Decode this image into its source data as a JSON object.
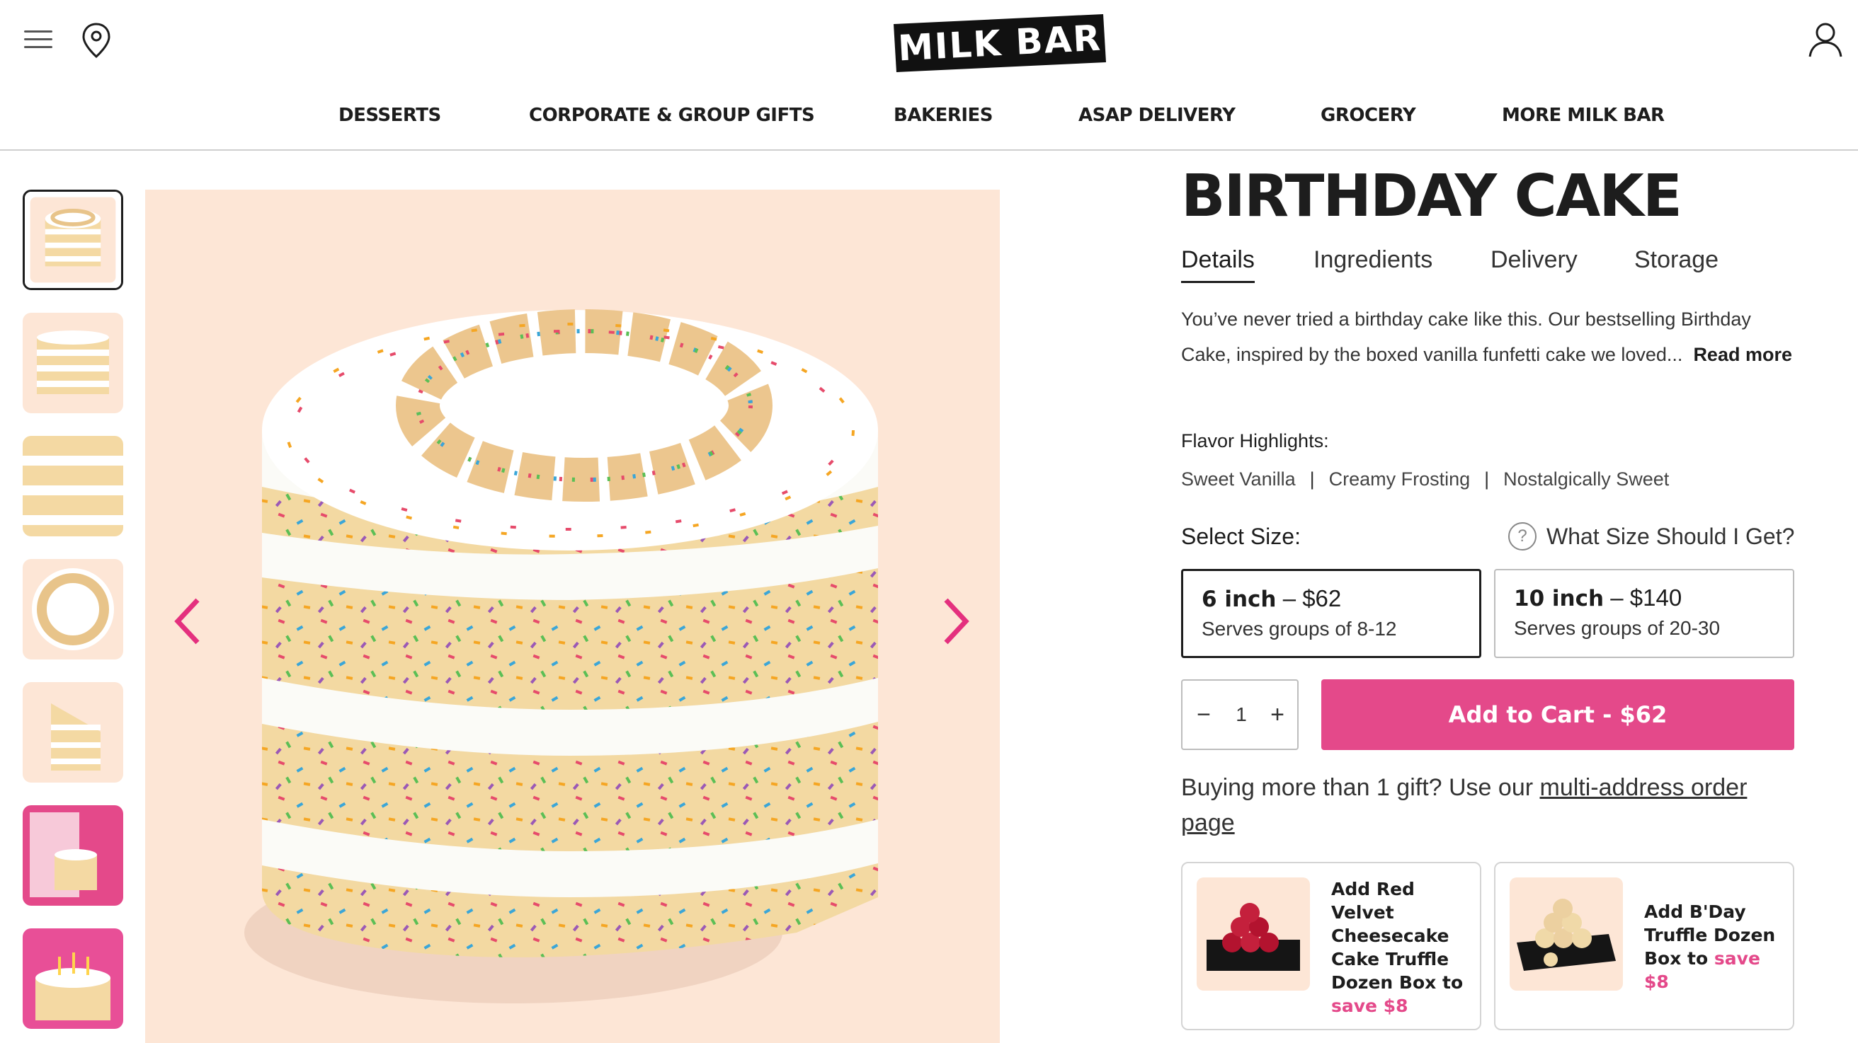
{
  "brand": {
    "logo_text": "MILK BAR",
    "accent_color": "#e4498a"
  },
  "header": {
    "icons": [
      "menu-icon",
      "location-pin-icon",
      "user-icon"
    ]
  },
  "nav": {
    "items": [
      {
        "label": "DESSERTS"
      },
      {
        "label": "CORPORATE & GROUP GIFTS"
      },
      {
        "label": "BAKERIES"
      },
      {
        "label": "ASAP DELIVERY"
      },
      {
        "label": "GROCERY"
      },
      {
        "label": "MORE MILK BAR"
      }
    ]
  },
  "gallery": {
    "thumbnail_count": 7,
    "selected_index": 0,
    "prev_icon": "chevron-left-icon",
    "next_icon": "chevron-right-icon"
  },
  "product": {
    "title": "BIRTHDAY CAKE",
    "tabs": [
      {
        "label": "Details"
      },
      {
        "label": "Ingredients"
      },
      {
        "label": "Delivery"
      },
      {
        "label": "Storage"
      }
    ],
    "description": "You’ve never tried a birthday cake like this. Our bestselling Birthday Cake, inspired by the boxed vanilla funfetti cake we loved...",
    "read_more": "Read more",
    "flavor_label": "Flavor Highlights:",
    "flavors": [
      "Sweet Vanilla",
      "Creamy Frosting",
      "Nostalgically Sweet"
    ],
    "flavor_separator": "|",
    "size_label": "Select Size:",
    "size_help": "What Size Should I Get?",
    "sizes": [
      {
        "size": "6 inch",
        "price": "– $62",
        "serves": "Serves groups of 8-12",
        "selected": true
      },
      {
        "size": "10 inch",
        "price": "– $140",
        "serves": "Serves groups of 20-30",
        "selected": false
      }
    ],
    "quantity": "1",
    "qty_minus": "−",
    "qty_plus": "+",
    "add_to_cart": "Add to Cart - $62",
    "gift_text": "Buying more than 1 gift? Use our ",
    "gift_link": "multi-address order page"
  },
  "upsells": [
    {
      "text": "Add Red Velvet Cheesecake Cake Truffle Dozen Box to",
      "save": "save $8"
    },
    {
      "text": "Add B'Day Truffle Dozen Box to",
      "save": "save $8"
    }
  ]
}
